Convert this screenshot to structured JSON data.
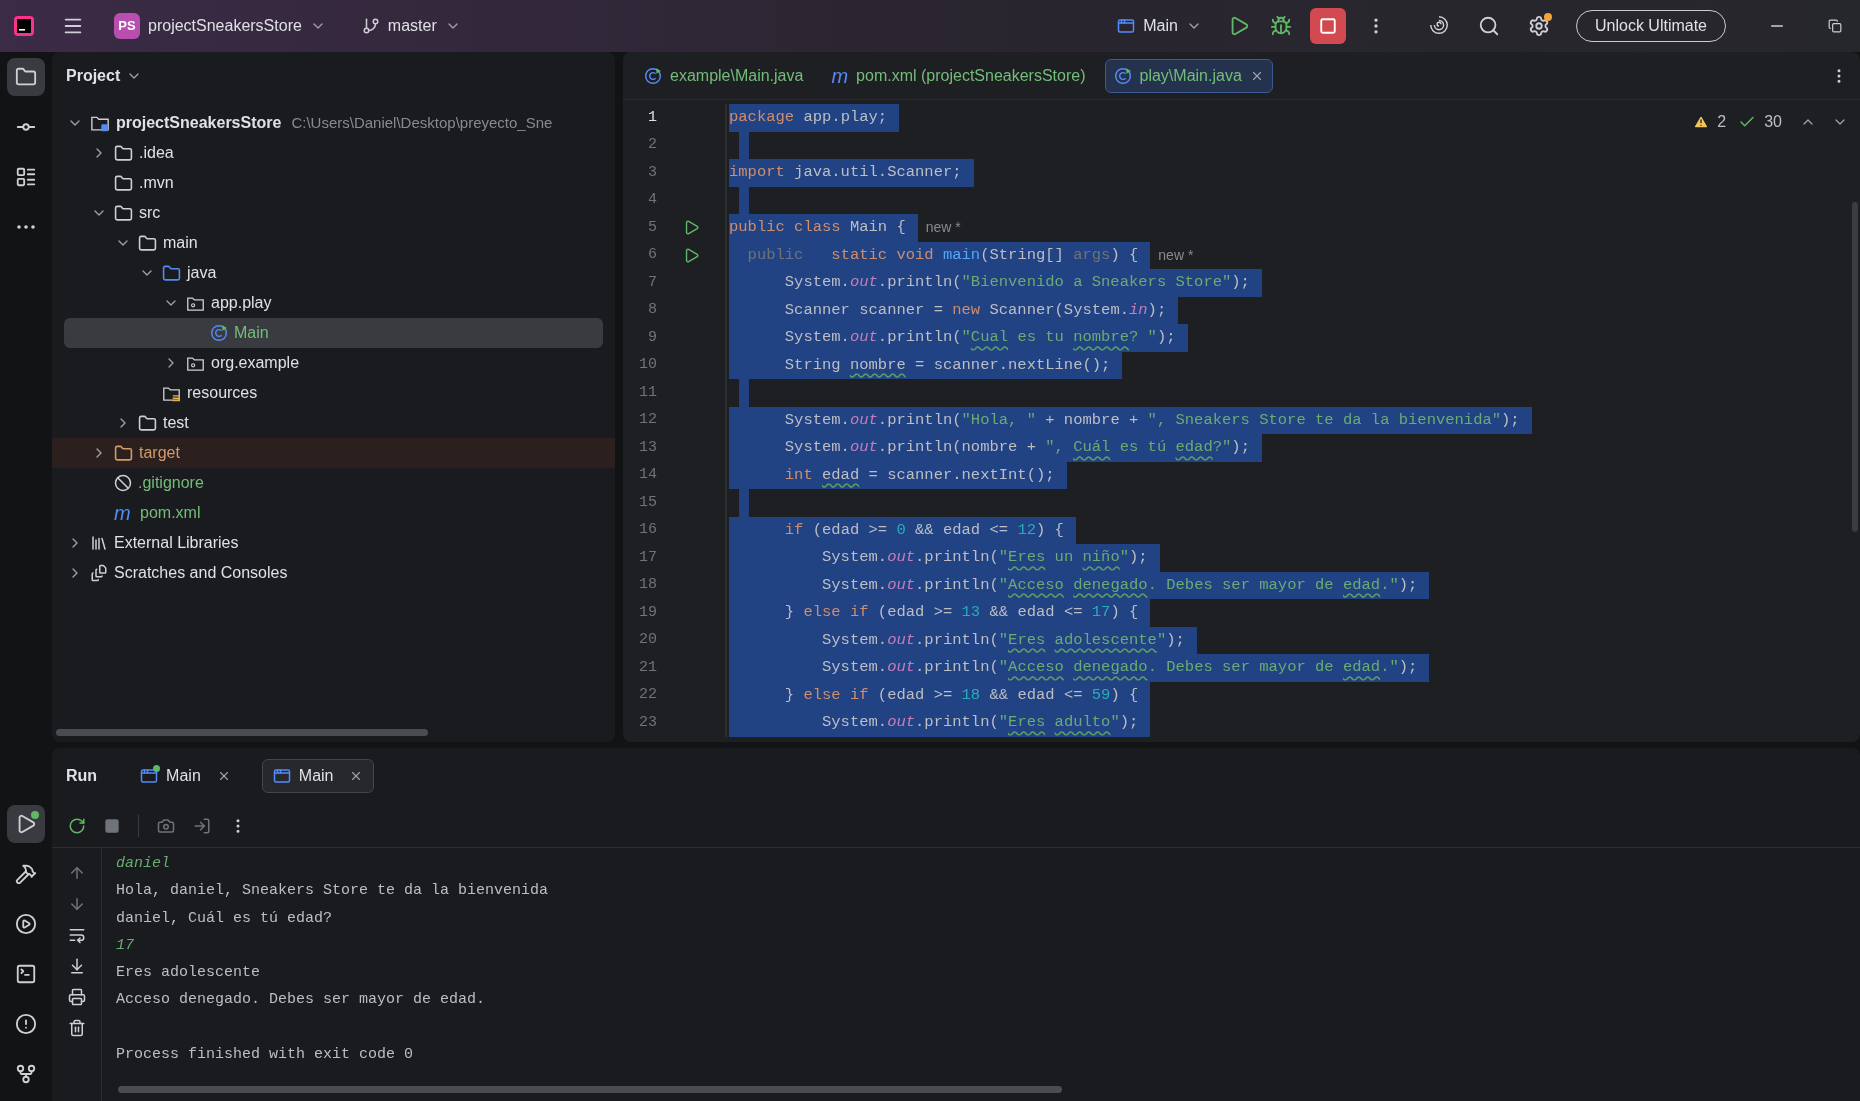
{
  "title_bar": {
    "project_badge": "PS",
    "project": "projectSneakersStore",
    "branch": "master",
    "run_config": "Main",
    "upgrade_button": "Unlock Ultimate"
  },
  "left_toolbar": {
    "top": [
      {
        "kind": "project",
        "selected": true
      },
      {
        "kind": "commit",
        "selected": false
      },
      {
        "kind": "structure",
        "selected": false
      },
      {
        "kind": "more",
        "selected": false
      }
    ],
    "bottom": [
      {
        "kind": "run",
        "selected": true
      },
      {
        "kind": "build",
        "selected": false
      },
      {
        "kind": "services",
        "selected": false
      },
      {
        "kind": "terminal",
        "selected": false
      },
      {
        "kind": "problems",
        "selected": false
      },
      {
        "kind": "git",
        "selected": false
      }
    ]
  },
  "project_panel": {
    "title": "Project",
    "tree": [
      {
        "label": "projectSneakersStore",
        "path": "C:\\Users\\Daniel\\Desktop\\preyecto_Sne",
        "kind": "module",
        "expanded": true,
        "selected": false,
        "excluded": false,
        "color": "#dfe1e5",
        "children": [
          {
            "label": ".idea",
            "kind": "folder",
            "expanded": false,
            "selected": false,
            "excluded": false,
            "color": "#dfe1e5"
          },
          {
            "label": ".mvn",
            "kind": "folder",
            "selected": false,
            "excluded": false,
            "color": "#dfe1e5"
          },
          {
            "label": "src",
            "kind": "folder",
            "expanded": true,
            "selected": false,
            "excluded": false,
            "color": "#dfe1e5",
            "children": [
              {
                "label": "main",
                "kind": "folder",
                "expanded": true,
                "selected": false,
                "excluded": false,
                "color": "#dfe1e5",
                "children": [
                  {
                    "label": "java",
                    "kind": "source",
                    "expanded": true,
                    "selected": false,
                    "excluded": false,
                    "color": "#dfe1e5",
                    "children": [
                      {
                        "label": "app.play",
                        "kind": "package",
                        "expanded": true,
                        "selected": false,
                        "excluded": false,
                        "color": "#dfe1e5",
                        "children": [
                          {
                            "label": "Main",
                            "kind": "class",
                            "selected": true,
                            "excluded": false,
                            "color": "#73bd79"
                          }
                        ]
                      },
                      {
                        "label": "org.example",
                        "kind": "package",
                        "expanded": false,
                        "selected": false,
                        "excluded": false,
                        "color": "#dfe1e5"
                      }
                    ]
                  },
                  {
                    "label": "resources",
                    "kind": "resources",
                    "selected": false,
                    "excluded": false,
                    "color": "#dfe1e5"
                  }
                ]
              },
              {
                "label": "test",
                "kind": "folder",
                "expanded": false,
                "selected": false,
                "excluded": false,
                "color": "#dfe1e5"
              }
            ]
          },
          {
            "label": "target",
            "kind": "excluded",
            "expanded": false,
            "selected": false,
            "excluded": true,
            "color": "#d49a6a"
          },
          {
            "label": ".gitignore",
            "kind": "ignore",
            "selected": false,
            "excluded": false,
            "color": "#73bd79"
          },
          {
            "label": "pom.xml",
            "kind": "maven",
            "glyph": "m",
            "selected": false,
            "excluded": false,
            "color": "#73bd79"
          }
        ]
      },
      {
        "label": "External Libraries",
        "kind": "libraries",
        "expanded": false,
        "selected": false,
        "excluded": false,
        "color": "#dfe1e5"
      },
      {
        "label": "Scratches and Consoles",
        "kind": "scratches",
        "expanded": false,
        "selected": false,
        "excluded": false,
        "color": "#dfe1e5"
      }
    ]
  },
  "editor": {
    "tabs": [
      {
        "label": "example\\Main.java",
        "kind": "class",
        "selected": false
      },
      {
        "label": "pom.xml (projectSneakersStore)",
        "kind": "maven",
        "glyph": "m",
        "selected": false
      },
      {
        "label": "play\\Main.java",
        "kind": "class",
        "selected": true
      }
    ],
    "inspections": {
      "warnings": "2",
      "checks": "30"
    },
    "lines": [
      {
        "number": "1",
        "selected": true,
        "run": false,
        "tokens": [
          {
            "kind": "kw",
            "text": "package"
          },
          {
            "kind": "plain",
            "text": " app.play;"
          }
        ]
      },
      {
        "number": "2",
        "selected": true,
        "run": false
      },
      {
        "number": "3",
        "selected": true,
        "run": false,
        "tokens": [
          {
            "kind": "kw",
            "text": "import"
          },
          {
            "kind": "plain",
            "text": " java.util.Scanner;"
          }
        ]
      },
      {
        "number": "4",
        "selected": true,
        "run": false
      },
      {
        "number": "5",
        "selected": true,
        "run": true,
        "hint": "new *",
        "tokens": [
          {
            "kind": "kw",
            "text": "public class"
          },
          {
            "kind": "plain",
            "text": " Main {"
          }
        ]
      },
      {
        "number": "6",
        "selected": true,
        "run": true,
        "hint": "new *",
        "tokens": [
          {
            "kind": "dim",
            "text": "  public"
          },
          {
            "kind": "kw",
            "text": "   static void "
          },
          {
            "kind": "method",
            "text": "main"
          },
          {
            "kind": "plain",
            "text": "(String[] "
          },
          {
            "kind": "dim",
            "text": "args"
          },
          {
            "kind": "plain",
            "text": ") {"
          }
        ]
      },
      {
        "number": "7",
        "selected": true,
        "run": false,
        "tokens": [
          {
            "kind": "plain",
            "text": "      System."
          },
          {
            "kind": "field",
            "text": "out"
          },
          {
            "kind": "plain",
            "text": ".println("
          },
          {
            "kind": "str",
            "text": "\"Bienvenido a Sneakers Store\""
          },
          {
            "kind": "plain",
            "text": ");"
          }
        ]
      },
      {
        "number": "8",
        "selected": true,
        "run": false,
        "tokens": [
          {
            "kind": "plain",
            "text": "      Scanner scanner = "
          },
          {
            "kind": "kw",
            "text": "new"
          },
          {
            "kind": "plain",
            "text": " Scanner(System."
          },
          {
            "kind": "field",
            "text": "in"
          },
          {
            "kind": "plain",
            "text": ");"
          }
        ]
      },
      {
        "number": "9",
        "selected": true,
        "run": false,
        "tokens": [
          {
            "kind": "plain",
            "text": "      System."
          },
          {
            "kind": "field",
            "text": "out"
          },
          {
            "kind": "plain",
            "text": ".println("
          },
          {
            "kind": "str",
            "text": "\""
          },
          {
            "kind": "str",
            "text": "Cual",
            "underlined": true
          },
          {
            "kind": "str",
            "text": " es tu "
          },
          {
            "kind": "str",
            "text": "nombre",
            "underlined": true
          },
          {
            "kind": "str",
            "text": "? \""
          },
          {
            "kind": "plain",
            "text": ");"
          }
        ]
      },
      {
        "number": "10",
        "selected": true,
        "run": false,
        "tokens": [
          {
            "kind": "plain",
            "text": "      String "
          },
          {
            "kind": "plain",
            "text": "nombre",
            "underlined": true
          },
          {
            "kind": "plain",
            "text": " = scanner.nextLine();"
          }
        ]
      },
      {
        "number": "11",
        "selected": true,
        "run": false
      },
      {
        "number": "12",
        "selected": true,
        "run": false,
        "tokens": [
          {
            "kind": "plain",
            "text": "      System."
          },
          {
            "kind": "field",
            "text": "out"
          },
          {
            "kind": "plain",
            "text": ".println("
          },
          {
            "kind": "str",
            "text": "\"Hola, \""
          },
          {
            "kind": "plain",
            "text": " + nombre + "
          },
          {
            "kind": "str",
            "text": "\", Sneakers Store te da la bienvenida\""
          },
          {
            "kind": "plain",
            "text": ");"
          }
        ]
      },
      {
        "number": "13",
        "selected": true,
        "run": false,
        "tokens": [
          {
            "kind": "plain",
            "text": "      System."
          },
          {
            "kind": "field",
            "text": "out"
          },
          {
            "kind": "plain",
            "text": ".println(nombre + "
          },
          {
            "kind": "str",
            "text": "\", "
          },
          {
            "kind": "str",
            "text": "Cuál",
            "underlined": true
          },
          {
            "kind": "str",
            "text": " es tú "
          },
          {
            "kind": "str",
            "text": "edad",
            "underlined": true
          },
          {
            "kind": "str",
            "text": "?\""
          },
          {
            "kind": "plain",
            "text": ");"
          }
        ]
      },
      {
        "number": "14",
        "selected": true,
        "run": false,
        "tokens": [
          {
            "kind": "kw",
            "text": "      int "
          },
          {
            "kind": "plain",
            "text": "edad",
            "underlined": true
          },
          {
            "kind": "plain",
            "text": " = scanner.nextInt();"
          }
        ]
      },
      {
        "number": "15",
        "selected": true,
        "run": false
      },
      {
        "number": "16",
        "selected": true,
        "run": false,
        "tokens": [
          {
            "kind": "kw",
            "text": "      if"
          },
          {
            "kind": "plain",
            "text": " (edad >= "
          },
          {
            "kind": "num",
            "text": "0"
          },
          {
            "kind": "plain",
            "text": " && edad <= "
          },
          {
            "kind": "num",
            "text": "12"
          },
          {
            "kind": "plain",
            "text": ") {"
          }
        ]
      },
      {
        "number": "17",
        "selected": true,
        "run": false,
        "tokens": [
          {
            "kind": "plain",
            "text": "          System."
          },
          {
            "kind": "field",
            "text": "out"
          },
          {
            "kind": "plain",
            "text": ".println("
          },
          {
            "kind": "str",
            "text": "\""
          },
          {
            "kind": "str",
            "text": "Eres",
            "underlined": true
          },
          {
            "kind": "str",
            "text": " un "
          },
          {
            "kind": "str",
            "text": "niño",
            "underlined": true
          },
          {
            "kind": "str",
            "text": "\""
          },
          {
            "kind": "plain",
            "text": ");"
          }
        ]
      },
      {
        "number": "18",
        "selected": true,
        "run": false,
        "tokens": [
          {
            "kind": "plain",
            "text": "          System."
          },
          {
            "kind": "field",
            "text": "out"
          },
          {
            "kind": "plain",
            "text": ".println("
          },
          {
            "kind": "str",
            "text": "\""
          },
          {
            "kind": "str",
            "text": "Acceso ",
            "underlined": true
          },
          {
            "kind": "str",
            "text": "denegado",
            "underlined": true
          },
          {
            "kind": "str",
            "text": ". Debes ser mayor de "
          },
          {
            "kind": "str",
            "text": "edad",
            "underlined": true
          },
          {
            "kind": "str",
            "text": ".\""
          },
          {
            "kind": "plain",
            "text": ");"
          }
        ]
      },
      {
        "number": "19",
        "selected": true,
        "run": false,
        "tokens": [
          {
            "kind": "plain",
            "text": "      } "
          },
          {
            "kind": "kw",
            "text": "else if"
          },
          {
            "kind": "plain",
            "text": " (edad >= "
          },
          {
            "kind": "num",
            "text": "13"
          },
          {
            "kind": "plain",
            "text": " && edad <= "
          },
          {
            "kind": "num",
            "text": "17"
          },
          {
            "kind": "plain",
            "text": ") {"
          }
        ]
      },
      {
        "number": "20",
        "selected": true,
        "run": false,
        "tokens": [
          {
            "kind": "plain",
            "text": "          System."
          },
          {
            "kind": "field",
            "text": "out"
          },
          {
            "kind": "plain",
            "text": ".println("
          },
          {
            "kind": "str",
            "text": "\""
          },
          {
            "kind": "str",
            "text": "Eres ",
            "underlined": true
          },
          {
            "kind": "str",
            "text": "adolescente",
            "underlined": true
          },
          {
            "kind": "str",
            "text": "\""
          },
          {
            "kind": "plain",
            "text": ");"
          }
        ]
      },
      {
        "number": "21",
        "selected": true,
        "run": false,
        "tokens": [
          {
            "kind": "plain",
            "text": "          System."
          },
          {
            "kind": "field",
            "text": "out"
          },
          {
            "kind": "plain",
            "text": ".println("
          },
          {
            "kind": "str",
            "text": "\""
          },
          {
            "kind": "str",
            "text": "Acceso ",
            "underlined": true
          },
          {
            "kind": "str",
            "text": "denegado",
            "underlined": true
          },
          {
            "kind": "str",
            "text": ". Debes ser mayor de "
          },
          {
            "kind": "str",
            "text": "edad",
            "underlined": true
          },
          {
            "kind": "str",
            "text": ".\""
          },
          {
            "kind": "plain",
            "text": ");"
          }
        ]
      },
      {
        "number": "22",
        "selected": true,
        "run": false,
        "tokens": [
          {
            "kind": "plain",
            "text": "      } "
          },
          {
            "kind": "kw",
            "text": "else if"
          },
          {
            "kind": "plain",
            "text": " (edad >= "
          },
          {
            "kind": "num",
            "text": "18"
          },
          {
            "kind": "plain",
            "text": " && edad <= "
          },
          {
            "kind": "num",
            "text": "59"
          },
          {
            "kind": "plain",
            "text": ") {"
          }
        ]
      },
      {
        "number": "23",
        "selected": true,
        "run": false,
        "tokens": [
          {
            "kind": "plain",
            "text": "          System."
          },
          {
            "kind": "field",
            "text": "out"
          },
          {
            "kind": "plain",
            "text": ".println("
          },
          {
            "kind": "str",
            "text": "\""
          },
          {
            "kind": "str",
            "text": "Eres ",
            "underlined": true
          },
          {
            "kind": "str",
            "text": "adulto",
            "underlined": true
          },
          {
            "kind": "str",
            "text": "\""
          },
          {
            "kind": "plain",
            "text": ");"
          }
        ]
      }
    ]
  },
  "run_panel": {
    "title": "Run",
    "tabs": [
      {
        "label": "Main",
        "selected": false,
        "running": true
      },
      {
        "label": "Main",
        "selected": true,
        "running": false
      }
    ],
    "console": [
      {
        "kind": "input",
        "text": "daniel"
      },
      {
        "kind": "output",
        "text": "Hola, daniel, Sneakers Store te da la bienvenida"
      },
      {
        "kind": "output",
        "text": "daniel, Cuál es tú edad?"
      },
      {
        "kind": "input",
        "text": "17"
      },
      {
        "kind": "output",
        "text": "Eres adolescente"
      },
      {
        "kind": "output",
        "text": "Acceso denegado. Debes ser mayor de edad."
      },
      {
        "kind": "exit",
        "text": "Process finished with exit code 0"
      }
    ]
  }
}
